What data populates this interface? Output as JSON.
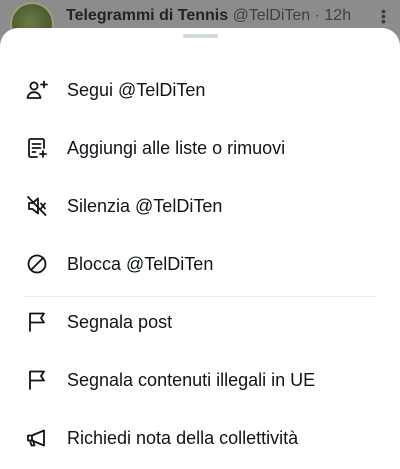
{
  "background_post": {
    "author_name": "Telegrammi di Tennis",
    "author_handle": "@TelDiTen",
    "separator": "·",
    "time": "12h",
    "more_icon": "more-vertical-icon"
  },
  "menu": {
    "items": [
      {
        "label": "Segui @TelDiTen",
        "icon": "follow-user-icon"
      },
      {
        "label": "Aggiungi alle liste o rimuovi",
        "icon": "list-add-icon"
      },
      {
        "label": "Silenzia @TelDiTen",
        "icon": "mute-icon"
      },
      {
        "label": "Blocca @TelDiTen",
        "icon": "block-icon"
      },
      {
        "label": "Segnala post",
        "icon": "flag-icon"
      },
      {
        "label": "Segnala contenuti illegali in UE",
        "icon": "flag-icon"
      },
      {
        "label": "Richiedi nota della collettività",
        "icon": "megaphone-icon"
      }
    ]
  },
  "colors": {
    "text": "#0f1419",
    "icon": "#0f1419",
    "divider": "#e6ecf0",
    "overlay": "#8a8a8a"
  }
}
